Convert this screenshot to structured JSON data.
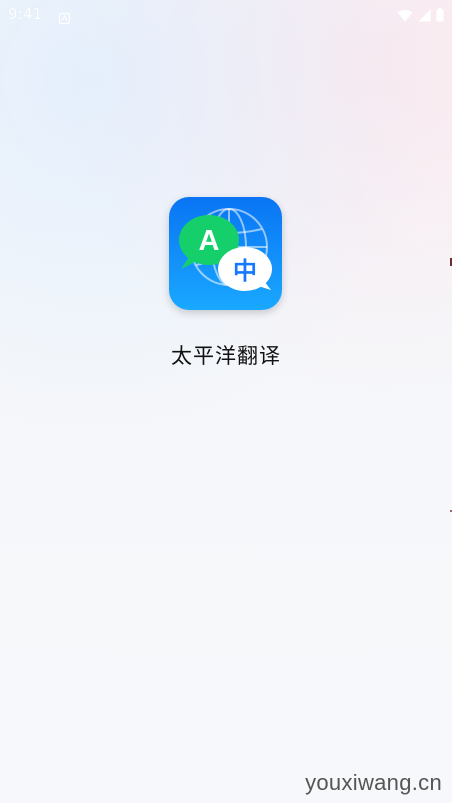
{
  "status_bar": {
    "time": "9:41",
    "icons": [
      "notification-icon",
      "wifi-icon",
      "cellular-signal-icon",
      "battery-icon"
    ]
  },
  "splash": {
    "app_icon": {
      "description_icon": "translate-app-icon",
      "bubble_left_text": "A",
      "bubble_right_text": "中",
      "colors": {
        "background_top": "#0a74f4",
        "background_bottom": "#19a8ff",
        "bubble_green": "#15d06a",
        "bubble_white": "#ffffff",
        "text_blue": "#1677ff"
      }
    },
    "app_name": "太平洋翻译"
  },
  "watermark": "youxiwang.cn"
}
